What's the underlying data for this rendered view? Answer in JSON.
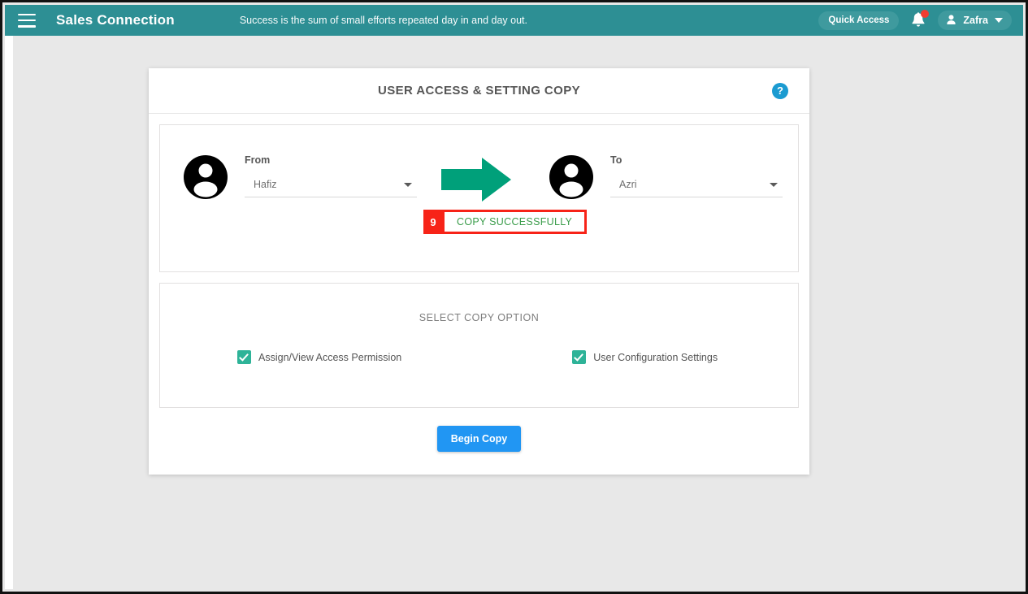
{
  "appbar": {
    "menu_icon": "hamburger-icon",
    "brand": "Sales Connection",
    "tagline": "Success is the sum of small efforts repeated day in and day out.",
    "quick_access_label": "Quick Access",
    "bell_icon": "notification-bell-icon",
    "bell_has_badge": true,
    "user_name": "Zafra",
    "user_icon": "person-icon",
    "chevron_icon": "chevron-down-icon",
    "bar_color": "#2d8f94",
    "pill_color": "#3f9a9e",
    "badge_color": "#f03c31"
  },
  "card": {
    "title": "USER ACCESS & SETTING COPY",
    "help_icon": "help-circle-icon",
    "help_glyph": "?",
    "help_color": "#1b9bd1"
  },
  "transfer": {
    "from": {
      "avatar_icon": "user-avatar-icon",
      "label": "From",
      "value": "Hafiz",
      "caret_icon": "dropdown-caret-icon"
    },
    "arrow_icon": "right-arrow-icon",
    "arrow_color": "#00a07a",
    "to": {
      "avatar_icon": "user-avatar-icon",
      "label": "To",
      "value": "Azri",
      "caret_icon": "dropdown-caret-icon"
    },
    "annotation": {
      "step_number": "9",
      "badge_color": "#f72318"
    },
    "status_message": "COPY SUCCESSFULLY",
    "status_color": "#3a9c4a"
  },
  "options": {
    "title": "SELECT COPY OPTION",
    "checkbox_color": "#2eb398",
    "items": [
      {
        "label": "Assign/View Access Permission",
        "checked": true
      },
      {
        "label": "User Configuration Settings",
        "checked": true
      }
    ]
  },
  "footer": {
    "begin_copy_label": "Begin Copy",
    "button_color": "#2196f3"
  }
}
